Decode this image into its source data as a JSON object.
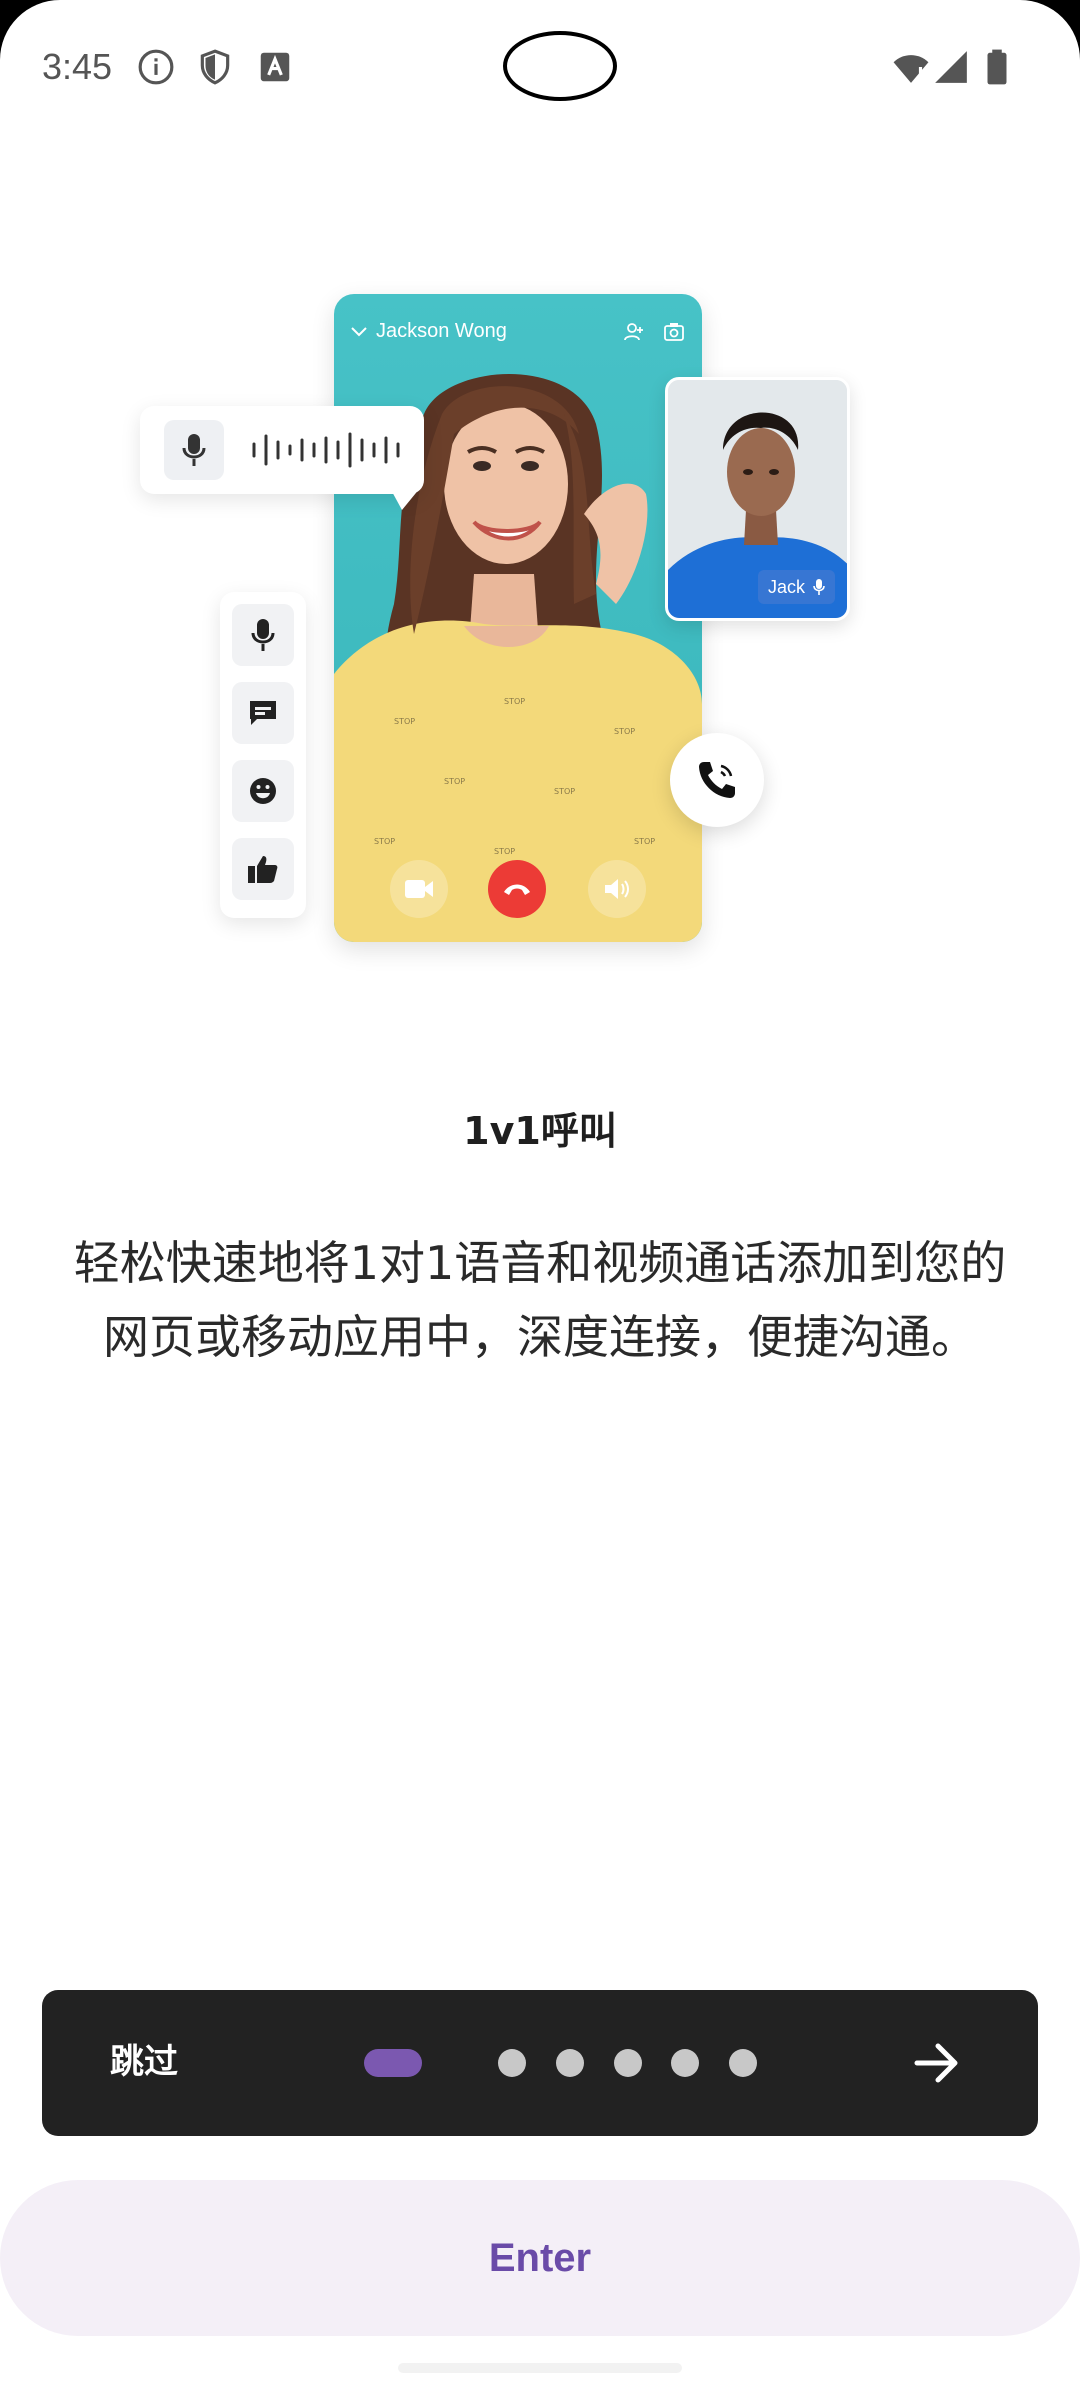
{
  "status_bar": {
    "time": "3:45",
    "left_icons": [
      "info-icon",
      "shield-icon",
      "text-a-icon"
    ],
    "right_icons": [
      "wifi-icon",
      "signal-icon",
      "battery-icon"
    ]
  },
  "illustration": {
    "caller_name": "Jackson Wong",
    "pip_name": "Jack",
    "accent_teal": "#3ebcc1",
    "hangup_red": "#ec3b36"
  },
  "content": {
    "title": "1v1呼叫",
    "description": "轻松快速地将1对1语音和视频通话添加到您的网页或移动应用中，深度连接，便捷沟通。"
  },
  "nav": {
    "skip_label": "跳过",
    "page_count": 6,
    "current_page": 1,
    "active_dot_color": "#7b58b0",
    "next_icon": "arrow-right-icon"
  },
  "enter_button": {
    "label": "Enter"
  }
}
